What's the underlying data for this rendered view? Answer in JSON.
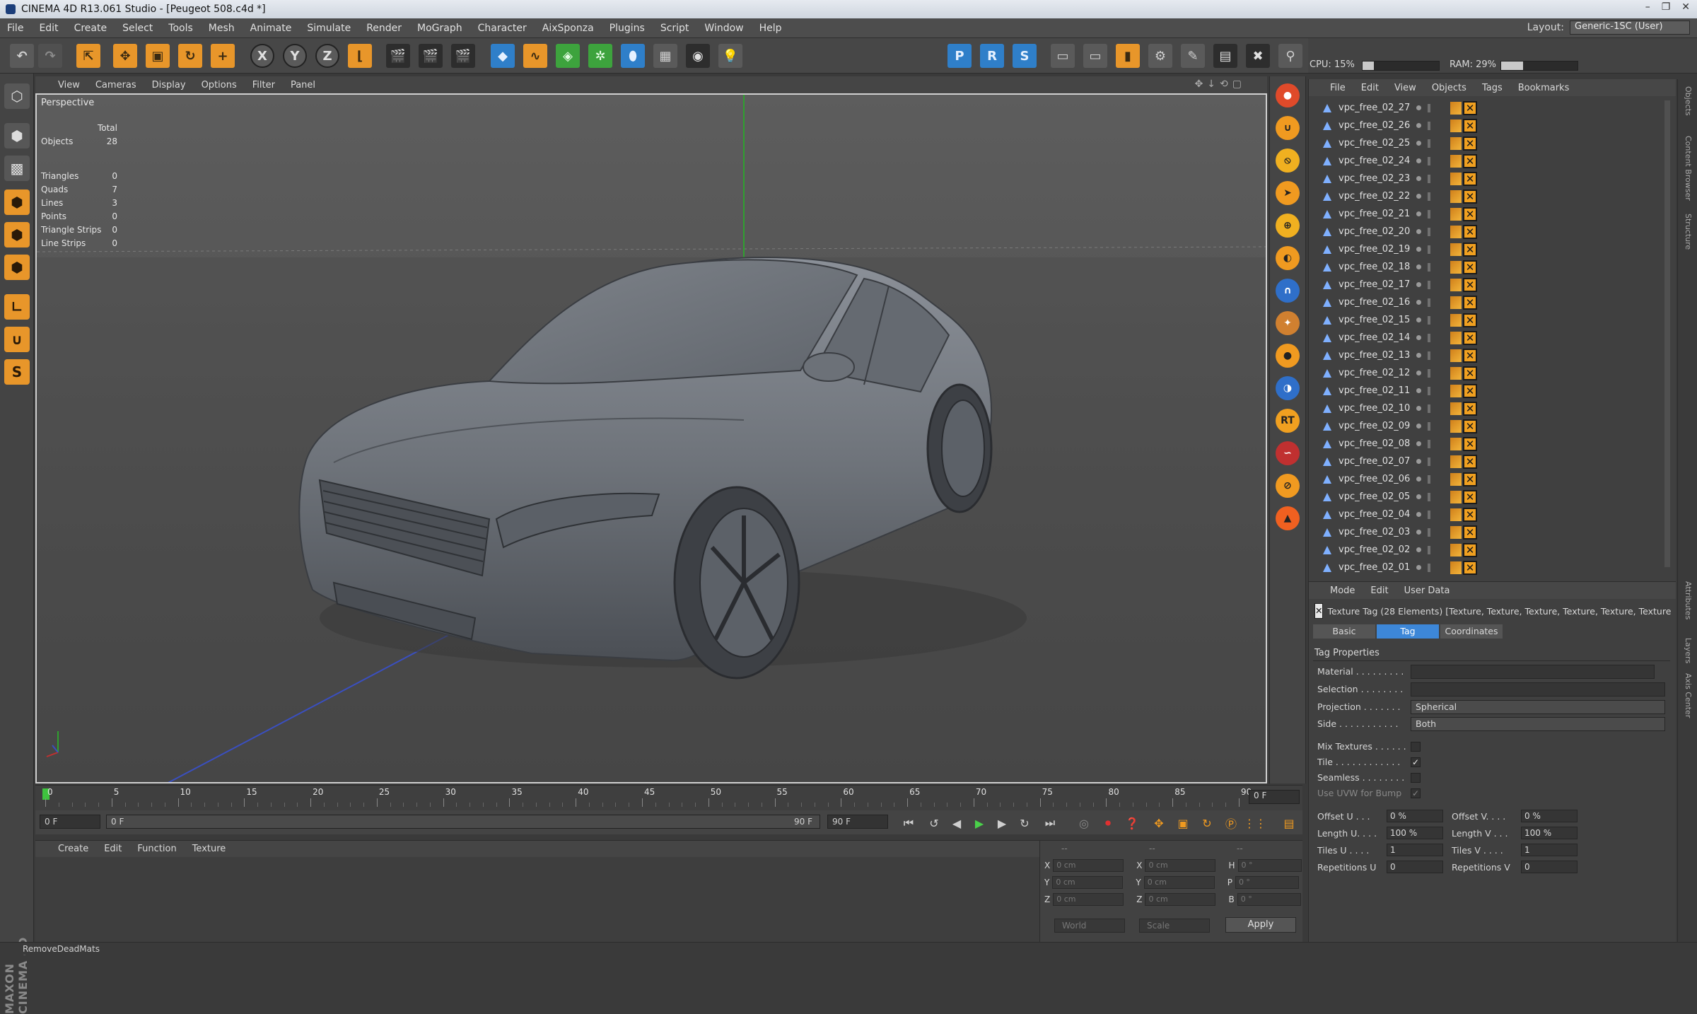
{
  "window": {
    "title": "CINEMA 4D R13.061 Studio - [Peugeot 508.c4d *]",
    "controls": [
      "–",
      "❐",
      "✕"
    ]
  },
  "menubar": {
    "items": [
      "File",
      "Edit",
      "Create",
      "Select",
      "Tools",
      "Mesh",
      "Animate",
      "Simulate",
      "Render",
      "MoGraph",
      "Character",
      "AixSponza",
      "Plugins",
      "Script",
      "Window",
      "Help"
    ],
    "layout_label": "Layout:",
    "layout_value": "Generic-1SC (User)"
  },
  "perf": {
    "cpu_label": "CPU: 15%",
    "cpu": 0.15,
    "ram_label": "RAM: 29%",
    "ram": 0.29
  },
  "toolbar": {
    "axis_x": "X",
    "axis_y": "Y",
    "axis_z": "Z",
    "render_p": "P",
    "render_r": "R",
    "render_s": "S"
  },
  "viewport": {
    "menu": [
      "View",
      "Cameras",
      "Display",
      "Options",
      "Filter",
      "Panel"
    ],
    "name": "Perspective",
    "stats_header": "Total",
    "objects_label": "Objects",
    "objects_value": "28",
    "stats": [
      {
        "label": "Triangles",
        "value": "0"
      },
      {
        "label": "Quads",
        "value": "7"
      },
      {
        "label": "Lines",
        "value": "3"
      },
      {
        "label": "Points",
        "value": "0"
      },
      {
        "label": "Triangle Strips",
        "value": "0"
      },
      {
        "label": "Line Strips",
        "value": "0"
      }
    ]
  },
  "timeline": {
    "ticks": [
      "0",
      "5",
      "10",
      "15",
      "20",
      "25",
      "30",
      "35",
      "40",
      "45",
      "50",
      "55",
      "60",
      "65",
      "70",
      "75",
      "80",
      "85",
      "90"
    ],
    "frame_end": "0 F"
  },
  "transport": {
    "start": "0 F",
    "range_start": "0 F",
    "range_end": "90 F",
    "end": "90 F"
  },
  "material_menu": [
    "Create",
    "Edit",
    "Function",
    "Texture"
  ],
  "coords": {
    "rows": [
      {
        "a": "X",
        "av": "0 cm",
        "b": "X",
        "bv": "0 cm",
        "c": "H",
        "cv": "0 °"
      },
      {
        "a": "Y",
        "av": "0 cm",
        "b": "Y",
        "bv": "0 cm",
        "c": "P",
        "cv": "0 °"
      },
      {
        "a": "Z",
        "av": "0 cm",
        "b": "Z",
        "bv": "0 cm",
        "c": "B",
        "cv": "0 °"
      }
    ],
    "header_a": "--",
    "header_b": "--",
    "header_c": "--",
    "mode": "World",
    "scale": "Scale",
    "apply": "Apply"
  },
  "status": "RemoveDeadMats",
  "logo": "MAXON CINEMA 4D",
  "objects_panel": {
    "menu": [
      "File",
      "Edit",
      "View",
      "Objects",
      "Tags",
      "Bookmarks"
    ],
    "items": [
      "vpc_free_02_27",
      "vpc_free_02_26",
      "vpc_free_02_25",
      "vpc_free_02_24",
      "vpc_free_02_23",
      "vpc_free_02_22",
      "vpc_free_02_21",
      "vpc_free_02_20",
      "vpc_free_02_19",
      "vpc_free_02_18",
      "vpc_free_02_17",
      "vpc_free_02_16",
      "vpc_free_02_15",
      "vpc_free_02_14",
      "vpc_free_02_13",
      "vpc_free_02_12",
      "vpc_free_02_11",
      "vpc_free_02_10",
      "vpc_free_02_09",
      "vpc_free_02_08",
      "vpc_free_02_07",
      "vpc_free_02_06",
      "vpc_free_02_05",
      "vpc_free_02_04",
      "vpc_free_02_03",
      "vpc_free_02_02",
      "vpc_free_02_01"
    ]
  },
  "attributes": {
    "menu": [
      "Mode",
      "Edit",
      "User Data"
    ],
    "title": "Texture Tag (28 Elements) [Texture, Texture, Texture, Texture, Texture, Texture,",
    "tabs": [
      "Basic",
      "Tag",
      "Coordinates"
    ],
    "section": "Tag Properties",
    "material_label": "Material . . . . . . . . .",
    "selection_label": "Selection . . . . . . . .",
    "projection_label": "Projection . . . . . . .",
    "projection_value": "Spherical",
    "side_label": "Side . . . . . . . . . . .",
    "side_value": "Both",
    "mix_label": "Mix Textures . . . . . .",
    "tile_label": "Tile . . . . . . . . . . . .",
    "seamless_label": "Seamless . . . . . . . .",
    "uvw_label": "Use UVW for Bump",
    "offset_u_label": "Offset U . . .",
    "offset_u": "0 %",
    "offset_v_label": "Offset V. . . .",
    "offset_v": "0 %",
    "length_u_label": "Length U. . . .",
    "length_u": "100 %",
    "length_v_label": "Length V . . .",
    "length_v": "100 %",
    "tiles_u_label": "Tiles U . . . .",
    "tiles_u": "1",
    "tiles_v_label": "Tiles V . . . .",
    "tiles_v": "1",
    "rep_u_label": "Repetitions U",
    "rep_u": "0",
    "rep_v_label": "Repetitions V",
    "rep_v": "0"
  },
  "side_tabs": [
    "Objects",
    "Content Browser",
    "Structure",
    "Attributes",
    "Layers",
    "Axis Center"
  ]
}
